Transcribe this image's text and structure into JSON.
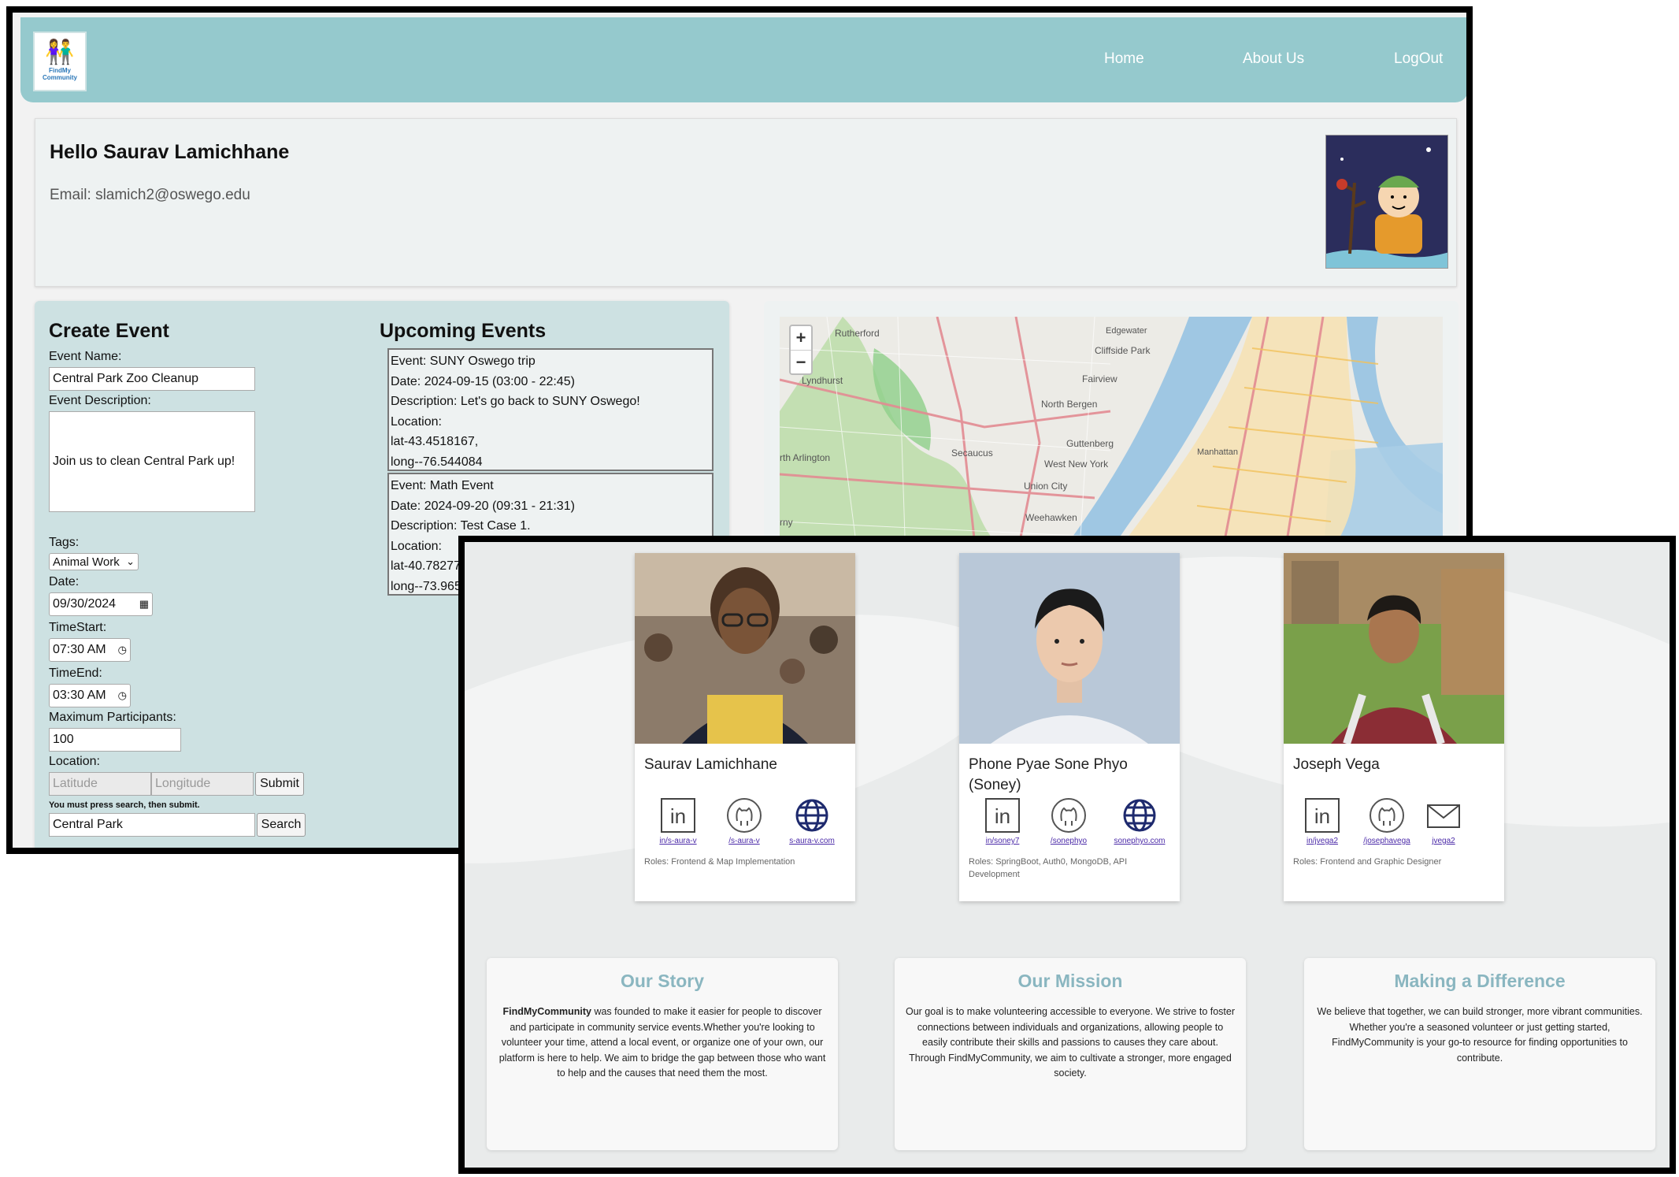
{
  "dashboard": {
    "nav": {
      "home": "Home",
      "about": "About Us",
      "logout": "LogOut"
    },
    "logo_text": "FindMy Community",
    "profile": {
      "greeting": "Hello Saurav Lamichhane",
      "email": "Email: slamich2@oswego.edu"
    },
    "create_event": {
      "title": "Create Event",
      "event_name_label": "Event Name:",
      "event_name_value": "Central Park Zoo Cleanup",
      "description_label": "Event Description:",
      "description_value": "Join us to clean Central Park up!",
      "tags_label": "Tags:",
      "tags_value": "Animal Work",
      "date_label": "Date:",
      "date_value": "09/30/2024",
      "time_start_label": "TimeStart:",
      "time_start_value": "07:30 AM",
      "time_end_label": "TimeEnd:",
      "time_end_value": "03:30 AM",
      "max_participants_label": "Maximum Participants:",
      "max_participants_value": "100",
      "location_label": "Location:",
      "latitude_placeholder": "Latitude",
      "longitude_placeholder": "Longitude",
      "submit_label": "Submit",
      "search_note": "You must press search, then submit.",
      "search_value": "Central Park",
      "search_label": "Search"
    },
    "upcoming": {
      "title": "Upcoming Events",
      "events": [
        {
          "name": "Event: SUNY Oswego trip",
          "date": "Date: 2024-09-15 (03:00 - 22:45)",
          "description": "Description: Let's go back to SUNY Oswego!",
          "location_label": "Location:",
          "lat": "lat-43.4518167,",
          "long": "long--76.544084"
        },
        {
          "name": "Event: Math Event",
          "date": "Date: 2024-09-20 (09:31 - 21:31)",
          "description": "Description: Test Case 1.",
          "location_label": "Location:",
          "lat": "lat-40.7827725",
          "long": "long--73.96536"
        }
      ]
    },
    "map": {
      "zoom_in": "+",
      "zoom_out": "−",
      "labels": [
        "Rutherford",
        "Edgewater",
        "Cliffside Park",
        "Lyndhurst",
        "Fairview",
        "North Bergen",
        "Guttenberg",
        "Secaucus",
        "rth Arlington",
        "West New York",
        "Manhattan",
        "Union City",
        "Weehawken",
        "rny"
      ]
    }
  },
  "about": {
    "members": [
      {
        "name": "Saurav Lamichhane",
        "links": [
          {
            "icon": "linkedin-icon",
            "text": "in/s-aura-v"
          },
          {
            "icon": "github-icon",
            "text": "/s-aura-v"
          },
          {
            "icon": "globe-icon",
            "text": "s-aura-v.com"
          }
        ],
        "roles": "Roles: Frontend & Map Implementation"
      },
      {
        "name": "Phone Pyae Sone Phyo (Soney)",
        "links": [
          {
            "icon": "linkedin-icon",
            "text": "in/soney7"
          },
          {
            "icon": "github-icon",
            "text": "/sonephyo"
          },
          {
            "icon": "globe-icon",
            "text": "sonephyo.com"
          }
        ],
        "roles": "Roles: SpringBoot, Auth0, MongoDB, API Development"
      },
      {
        "name": "Joseph Vega",
        "links": [
          {
            "icon": "linkedin-icon",
            "text": "in/jvega2"
          },
          {
            "icon": "github-icon",
            "text": "/josephavega"
          },
          {
            "icon": "mail-icon",
            "text": "jvega2"
          }
        ],
        "roles": "Roles: Frontend and Graphic Designer"
      }
    ],
    "sections": [
      {
        "title": "Our Story",
        "brand": "FindMyCommunity",
        "text": " was founded to make it easier for people to discover and participate in community service events.Whether you're looking to volunteer your time, attend a local event, or organize one of your own, our platform is here to help. We aim to bridge the gap between those who want to help and the causes that need them the most."
      },
      {
        "title": "Our Mission",
        "brand": "",
        "text": "Our goal is to make volunteering accessible to everyone. We strive to foster connections between individuals and organizations, allowing people to easily contribute their skills and passions to causes they care about. Through FindMyCommunity, we aim to cultivate a stronger, more engaged society."
      },
      {
        "title": "Making a Difference",
        "brand": "",
        "text": "We believe that together, we can build stronger, more vibrant communities. Whether you're a seasoned volunteer or just getting started, FindMyCommunity is your go-to resource for finding opportunities to contribute."
      }
    ]
  },
  "colors": {
    "navbar": "#95c9cd",
    "panel": "#cde1e2",
    "section_title": "#8ab6c0",
    "link": "#4b2aa8"
  }
}
